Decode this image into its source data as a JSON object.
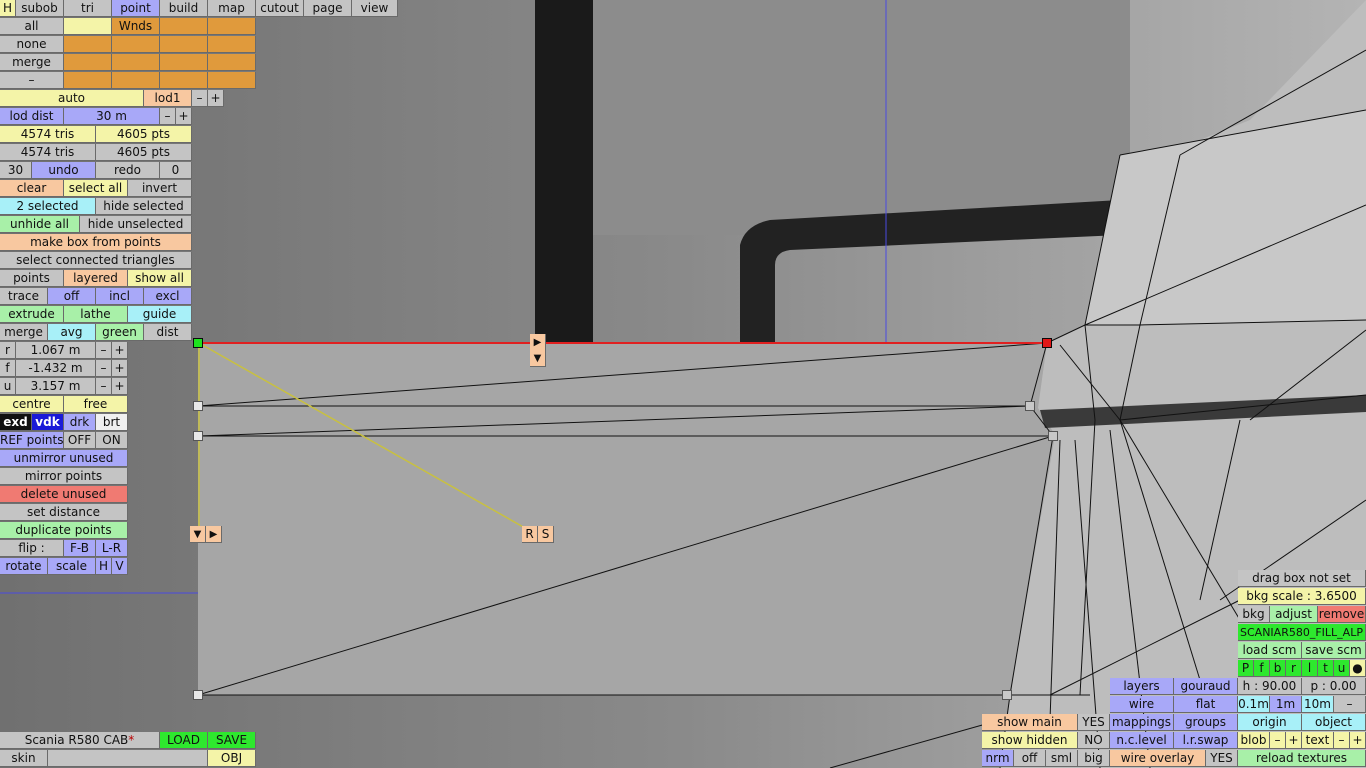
{
  "toolbar": {
    "tabs": [
      "H",
      "subob",
      "tri",
      "point",
      "build",
      "map",
      "cutout",
      "page",
      "view"
    ],
    "active_tab": "point"
  },
  "subobject": {
    "all": "all",
    "none": "none",
    "merge": "merge",
    "dash": "–",
    "wnds": "Wnds"
  },
  "lod": {
    "auto": "auto",
    "lod1": "lod1",
    "minus": "–",
    "plus": "+",
    "lod_dist_label": "lod dist",
    "lod_dist_value": "30 m"
  },
  "counts": {
    "tris_1": "4574 tris",
    "pts_1": "4605 pts",
    "tris_2": "4574 tris",
    "pts_2": "4605 pts"
  },
  "history": {
    "undo_count": "30",
    "undo": "undo",
    "redo": "redo",
    "redo_count": "0"
  },
  "selection": {
    "clear": "clear",
    "select_all": "select all",
    "invert": "invert",
    "selected": "2 selected",
    "hide_selected": "hide selected",
    "unhide_all": "unhide all",
    "hide_unselected": "hide unselected",
    "make_box": "make box from points",
    "select_connected": "select connected triangles"
  },
  "modes": {
    "points": "points",
    "layered": "layered",
    "show_all": "show all",
    "trace": "trace",
    "off": "off",
    "incl": "incl",
    "excl": "excl",
    "extrude": "extrude",
    "lathe": "lathe",
    "guide": "guide",
    "merge": "merge",
    "avg": "avg",
    "green": "green",
    "dist": "dist"
  },
  "coords": {
    "r_label": "r",
    "r_value": "1.067 m",
    "f_label": "f",
    "f_value": "-1.432 m",
    "u_label": "u",
    "u_value": "3.157 m",
    "minus": "–",
    "plus": "+"
  },
  "tools": {
    "centre": "centre",
    "free": "free",
    "exd": "exd",
    "vdk": "vdk",
    "drk": "drk",
    "brt": "brt",
    "ref_points": "REF points",
    "ref_off": "OFF",
    "ref_on": "ON",
    "unmirror_unused": "unmirror unused",
    "mirror_points": "mirror points",
    "delete_unused": "delete unused",
    "set_distance": "set distance",
    "duplicate_points": "duplicate points",
    "flip": "flip :",
    "fb": "F-B",
    "lr": "L-R",
    "rotate": "rotate",
    "scale": "scale",
    "h": "H",
    "v": "V"
  },
  "file": {
    "name": "Scania R580 CAB",
    "modified_mark": "*",
    "load": "LOAD",
    "save": "SAVE",
    "skin": "skin",
    "obj": "OBJ"
  },
  "viewport_markers": {
    "arrow_right": "▶",
    "arrow_down": "▼",
    "r": "R",
    "s": "S"
  },
  "right_panel": {
    "drag_box": "drag box not set",
    "bkg_scale": "bkg scale : 3.6500",
    "bkg": "bkg",
    "adjust": "adjust",
    "remove": "remove",
    "fill_name": "SCANIAR580_FILL_ALP",
    "load_scm": "load scm",
    "save_scm": "save scm",
    "views": [
      "P",
      "f",
      "b",
      "r",
      "l",
      "t",
      "u",
      "●"
    ],
    "h": "h : 90.00",
    "p": "p : 0.00",
    "step_01": "0.1m",
    "step_1": "1m",
    "step_10": "10m",
    "step_minus": "–",
    "origin": "origin",
    "object": "object",
    "blob": "blob",
    "text": "text",
    "minus": "–",
    "plus": "+",
    "reload_textures": "reload textures"
  },
  "display": {
    "layers": "layers",
    "gouraud": "gouraud",
    "wire": "wire",
    "flat": "flat",
    "mappings": "mappings",
    "groups": "groups",
    "nc_level": "n.c.level",
    "lr_swap": "l.r.swap",
    "wire_overlay": "wire overlay",
    "wire_overlay_state": "YES",
    "show_main": "show main",
    "show_main_state": "YES",
    "show_hidden": "show hidden",
    "show_hidden_state": "NO",
    "nrm": "nrm",
    "off": "off",
    "sml": "sml",
    "big": "big"
  },
  "colors": {
    "grey": "#c4c4c4",
    "yellow": "#f4f4a8",
    "purple": "#a8a8f8",
    "peach": "#f8c8a0",
    "green": "#a8f0a8",
    "cyan": "#a8f0f8",
    "orange": "#e09a3c",
    "red": "#f07a72",
    "lime": "#2ee82e"
  }
}
